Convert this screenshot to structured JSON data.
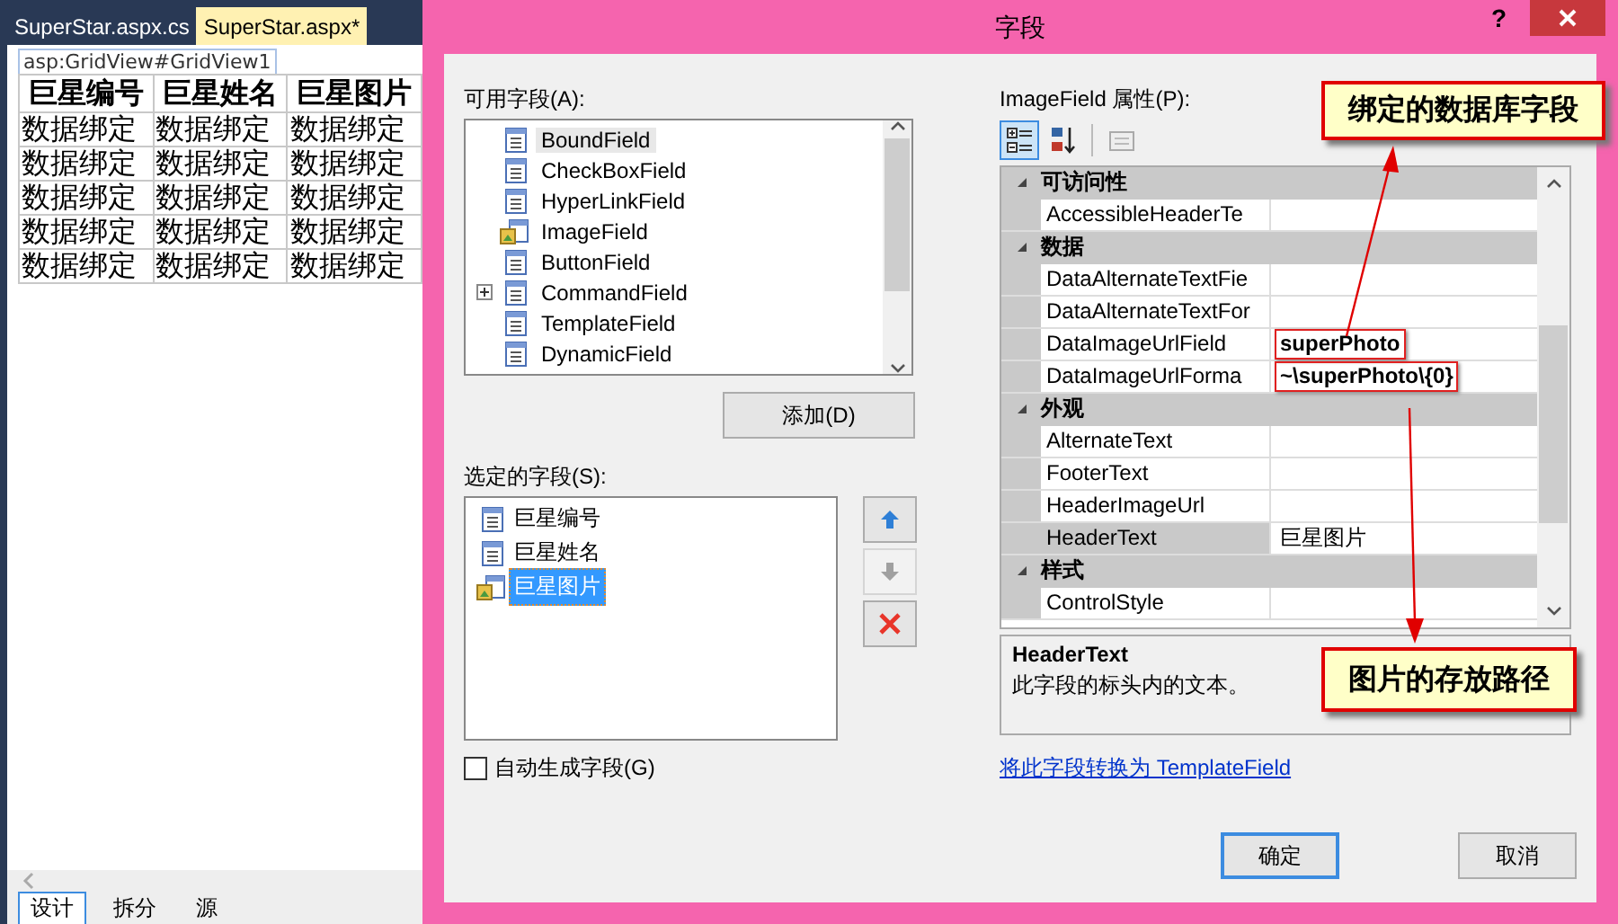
{
  "editor_tabs": [
    {
      "label": "SuperStar.aspx.cs",
      "selected": false
    },
    {
      "label": "SuperStar.aspx*",
      "selected": true
    }
  ],
  "designer": {
    "tag": "asp:GridView#GridView1",
    "columns": [
      "巨星编号",
      "巨星姓名",
      "巨星图片"
    ],
    "rows": [
      [
        "数据绑定",
        "数据绑定",
        "数据绑定"
      ],
      [
        "数据绑定",
        "数据绑定",
        "数据绑定"
      ],
      [
        "数据绑定",
        "数据绑定",
        "数据绑定"
      ],
      [
        "数据绑定",
        "数据绑定",
        "数据绑定"
      ],
      [
        "数据绑定",
        "数据绑定",
        "数据绑定"
      ]
    ]
  },
  "view_tabs": [
    {
      "label": "设计",
      "selected": true
    },
    {
      "label": "拆分",
      "selected": false
    },
    {
      "label": "源",
      "selected": false
    }
  ],
  "dialog": {
    "title": "字段",
    "help": "?",
    "available_label": "可用字段(A):",
    "available_fields": [
      {
        "label": "BoundField",
        "selected": true,
        "expandable": false
      },
      {
        "label": "CheckBoxField",
        "selected": false,
        "expandable": false
      },
      {
        "label": "HyperLinkField",
        "selected": false,
        "expandable": false
      },
      {
        "label": "ImageField",
        "selected": false,
        "expandable": false
      },
      {
        "label": "ButtonField",
        "selected": false,
        "expandable": false
      },
      {
        "label": "CommandField",
        "selected": false,
        "expandable": true
      },
      {
        "label": "TemplateField",
        "selected": false,
        "expandable": false
      },
      {
        "label": "DynamicField",
        "selected": false,
        "expandable": false
      }
    ],
    "add_button": "添加(D)",
    "selected_label": "选定的字段(S):",
    "selected_fields": [
      {
        "label": "巨星编号",
        "selected": false
      },
      {
        "label": "巨星姓名",
        "selected": false
      },
      {
        "label": "巨星图片",
        "selected": true
      }
    ],
    "move_buttons": [
      {
        "kind": "up",
        "disabled": false
      },
      {
        "kind": "down",
        "disabled": true
      },
      {
        "kind": "delete",
        "disabled": false
      }
    ],
    "auto_generate": {
      "label": "自动生成字段(G)",
      "checked": false
    },
    "properties_label": "ImageField 属性(P):",
    "toolbar": [
      {
        "kind": "categorized",
        "selected": true
      },
      {
        "kind": "alphabetical",
        "selected": false
      },
      {
        "kind": "pages",
        "selected": false
      }
    ],
    "property_grid": [
      {
        "kind": "category",
        "label": "可访问性",
        "expanded": true
      },
      {
        "kind": "property",
        "name": "AccessibleHeaderTe",
        "selected": false
      },
      {
        "kind": "category",
        "label": "数据",
        "expanded": true
      },
      {
        "kind": "property",
        "name": "DataAlternateTextFie",
        "selected": false
      },
      {
        "kind": "property",
        "name": "DataAlternateTextFor",
        "selected": false
      },
      {
        "kind": "property",
        "name": "DataImageUrlField",
        "value": "superPhoto",
        "modified": true,
        "highlighted": true,
        "selected": false
      },
      {
        "kind": "property",
        "name": "DataImageUrlForma",
        "value": "~\\superPhoto\\{0}",
        "modified": true,
        "highlighted": true,
        "selected": false
      },
      {
        "kind": "category",
        "label": "外观",
        "expanded": true
      },
      {
        "kind": "property",
        "name": "AlternateText",
        "selected": false
      },
      {
        "kind": "property",
        "name": "FooterText",
        "selected": false
      },
      {
        "kind": "property",
        "name": "HeaderImageUrl",
        "selected": false
      },
      {
        "kind": "property",
        "name": "HeaderText",
        "value": "巨星图片",
        "selected": true
      },
      {
        "kind": "category",
        "label": "样式",
        "expanded": true
      },
      {
        "kind": "property",
        "name": "ControlStyle",
        "selected": false
      }
    ],
    "description": {
      "title": "HeaderText",
      "text": "此字段的标头内的文本。"
    },
    "convert_link": "将此字段转换为 TemplateField",
    "buttons": [
      {
        "label": "确定",
        "default": true
      },
      {
        "label": "取消",
        "default": false
      }
    ]
  },
  "annotations": [
    {
      "text": "绑定的数据库字段"
    },
    {
      "text": "图片的存放路径"
    }
  ]
}
